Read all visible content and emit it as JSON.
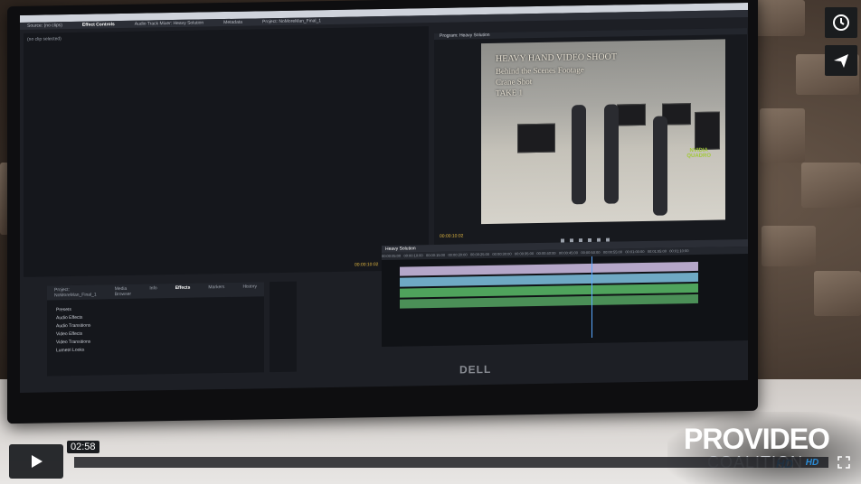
{
  "premiere": {
    "tabs": [
      "Source: (no clips)",
      "Effect Controls",
      "Audio Track Mixer: Heavy Solution",
      "Metadata",
      "Project: NoMoreMan_Final_1"
    ],
    "active_tab_index": 1,
    "effect_panel_message": "(no clip selected)",
    "program_monitor_title": "Program: Heavy Solution",
    "video_overlay": {
      "line1": "HEAVY HAND VIDEO SHOOT",
      "line2": "Behind the Scenes Footage",
      "line3": "Crane Shot",
      "line4": "TAKE 1"
    },
    "nvidia_label": "NVIDIA",
    "quadro_label": "QUADRO",
    "program_timecode": "00:00:10:02",
    "timeline_timecode": "00:00:10:02",
    "timeline_tab": "Heavy Solution",
    "ruler_ticks": [
      "00:00:05:00",
      "00:00:10:00",
      "00:00:15:00",
      "00:00:20:00",
      "00:00:25:00",
      "00:00:30:00",
      "00:00:35:00",
      "00:00:40:00",
      "00:00:45:00",
      "00:00:50:00",
      "00:00:55:00",
      "00:01:00:00",
      "00:01:05:00",
      "00:01:10:00"
    ],
    "project_tabs": [
      "Project: NoMoreMan_Final_1",
      "Media Browser",
      "Info",
      "Effects",
      "Markers",
      "History"
    ],
    "project_active_index": 3,
    "effects_tree": [
      "Presets",
      "Audio Effects",
      "Audio Transitions",
      "Video Effects",
      "Video Transitions",
      "Lumetri Looks"
    ]
  },
  "monitor_brand": "DELL",
  "side_buttons": {
    "watch_later_icon": "clock-icon",
    "share_icon": "paper-plane-icon"
  },
  "logo": {
    "main": "PROVIDEO",
    "sub": "COALITION",
    "hd": "HD"
  },
  "player": {
    "time": "02:58",
    "progress_fraction": 0.0,
    "hd_label": "HD"
  }
}
